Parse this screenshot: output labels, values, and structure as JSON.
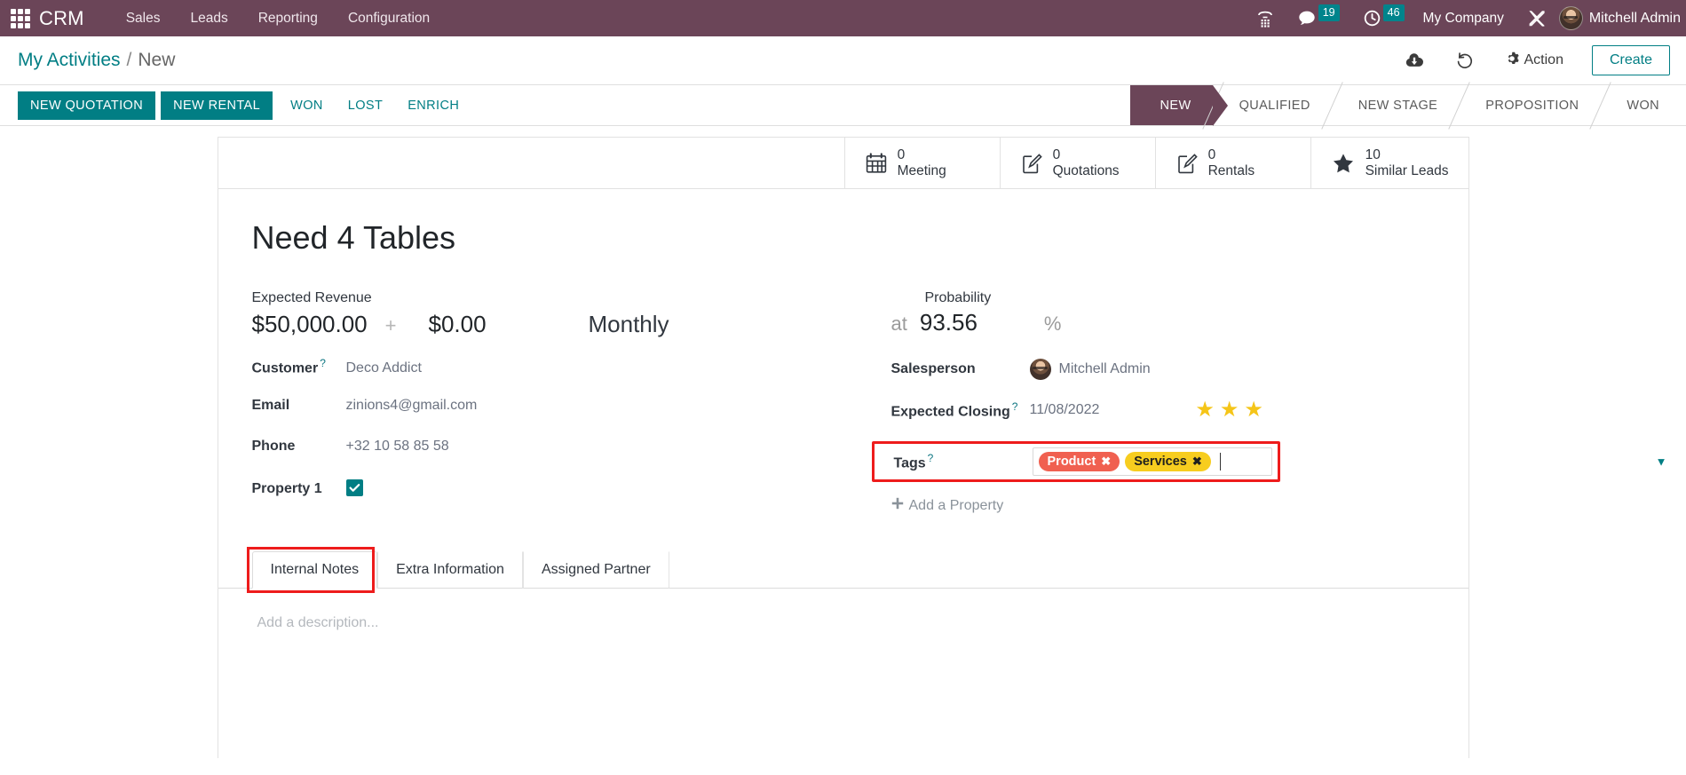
{
  "topbar": {
    "apps_icon": "apps-grid-icon",
    "app_name": "CRM",
    "menus": [
      "Sales",
      "Leads",
      "Reporting",
      "Configuration"
    ],
    "systray": {
      "voip_icon": "phone-dialpad-icon",
      "messages_icon": "chat-bubble-icon",
      "messages_count": "19",
      "activities_icon": "clock-icon",
      "activities_count": "46",
      "company": "My Company",
      "debug_icon": "tools-wrench-icon",
      "user_avatar": "user-avatar",
      "user_name": "Mitchell Admin"
    },
    "brand_color": "#6B4558",
    "badge_color": "#00848c"
  },
  "control_panel": {
    "breadcrumb_root": "My Activities",
    "breadcrumb_separator": "/",
    "breadcrumb_current": "New",
    "save_icon": "cloud-upload-icon",
    "discard_icon": "undo-icon",
    "action_icon": "gear-icon",
    "action_label": "Action",
    "create_label": "Create",
    "accent_color": "#017e84"
  },
  "action_buttons": [
    {
      "label": "NEW QUOTATION",
      "style": "primary"
    },
    {
      "label": "NEW RENTAL",
      "style": "primary"
    },
    {
      "label": "WON",
      "style": "link"
    },
    {
      "label": "LOST",
      "style": "link"
    },
    {
      "label": "ENRICH",
      "style": "link"
    }
  ],
  "statusbar": {
    "stages": [
      "NEW",
      "QUALIFIED",
      "NEW STAGE",
      "PROPOSITION",
      "WON"
    ],
    "active": "NEW"
  },
  "smart_buttons": [
    {
      "icon": "calendar-icon",
      "value": "0",
      "label": "Meeting"
    },
    {
      "icon": "pencil-square-icon",
      "value": "0",
      "label": "Quotations"
    },
    {
      "icon": "pencil-square-icon",
      "value": "0",
      "label": "Rentals"
    },
    {
      "icon": "star-icon",
      "value": "10",
      "label": "Similar Leads"
    }
  ],
  "record": {
    "title": "Need 4 Tables",
    "expected_revenue_label": "Expected Revenue",
    "expected_revenue": "$50,000.00",
    "plus": "+",
    "recurring_revenue": "$0.00",
    "recurring_period": "Monthly",
    "probability_label": "Probability",
    "probability_prefix": "at",
    "probability": "93.56",
    "probability_suffix": "%",
    "left_fields": [
      {
        "label": "Customer",
        "help": "?",
        "value": "Deco Addict",
        "type": "text"
      },
      {
        "label": "Email",
        "help": "",
        "value": "zinions4@gmail.com",
        "type": "text"
      },
      {
        "label": "Phone",
        "help": "",
        "value": "+32 10 58 85 58",
        "type": "text"
      },
      {
        "label": "Property 1",
        "help": "",
        "value": "",
        "type": "checkbox",
        "checked": true
      }
    ],
    "salesperson_label": "Salesperson",
    "salesperson": "Mitchell Admin",
    "expected_closing_label": "Expected Closing",
    "expected_closing_help": "?",
    "expected_closing": "11/08/2022",
    "priority_stars": 3,
    "priority_star_color": "#F5C518",
    "tags_label": "Tags",
    "tags_help": "?",
    "tags": [
      {
        "name": "Product",
        "bg": "#F06050",
        "fg": "#ffffff",
        "remove": "✖"
      },
      {
        "name": "Services",
        "bg": "#F7CD1F",
        "fg": "#1f1f1f",
        "remove": "✖"
      }
    ],
    "tags_dropdown_icon": "chevron-down-icon",
    "add_property_label": "Add a Property",
    "add_property_icon": "plus-icon",
    "highlight_color": "#ee1c1c"
  },
  "notebook": {
    "tabs": [
      {
        "label": "Internal Notes",
        "active": true
      },
      {
        "label": "Extra Information",
        "active": false
      },
      {
        "label": "Assigned Partner",
        "active": false
      }
    ],
    "description_placeholder": "Add a description..."
  }
}
